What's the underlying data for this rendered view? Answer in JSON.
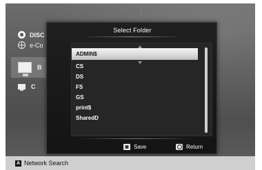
{
  "background_menu": {
    "disc_label": "DISC",
    "ecs_label": "e-Co",
    "pc_b_label": "B",
    "pc_c_label": "C"
  },
  "dialog": {
    "title": "Select Folder",
    "folders": [
      "ADMIN$",
      "CS",
      "DS",
      "FS",
      "GS",
      "print$",
      "SharedD"
    ],
    "selected_index": 0,
    "save_label": "Save",
    "return_label": "Return",
    "save_key_icon": "save-key-icon",
    "return_key_icon": "return-key-icon"
  },
  "bottom_bar": {
    "key_glyph": "A",
    "label": "Network Search"
  },
  "colors": {
    "dialog_bg": "#1a1a1a",
    "highlight": "#e0e0e0",
    "bottom_bar_bg": "#cfcfcf"
  }
}
